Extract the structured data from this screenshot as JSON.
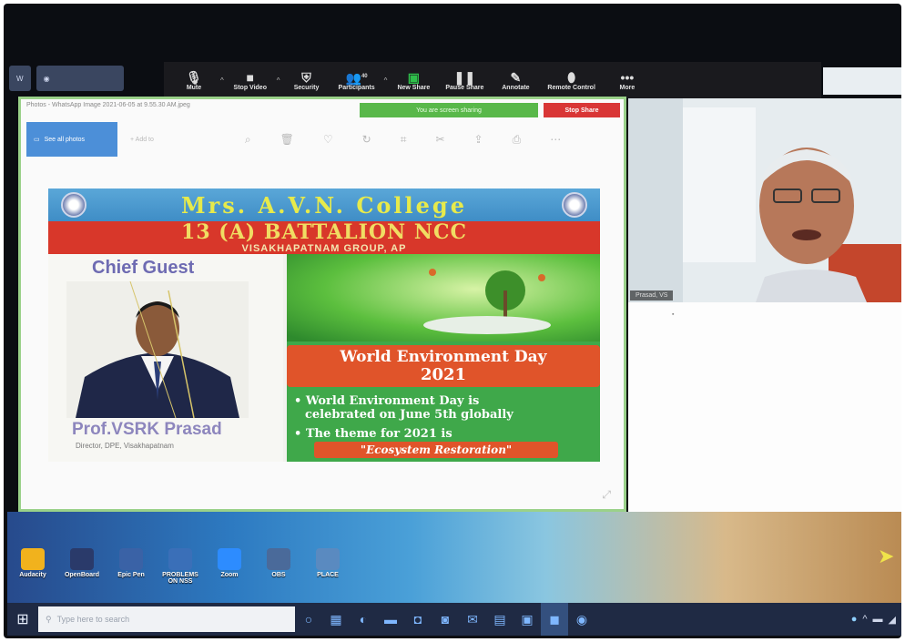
{
  "zoom_toolbar": {
    "items": [
      {
        "label": "Mute",
        "icon": "microphone-icon"
      },
      {
        "label": "Stop Video",
        "icon": "video-camera-icon"
      },
      {
        "label": "Security",
        "icon": "shield-icon"
      },
      {
        "label": "Participants",
        "icon": "participants-icon",
        "count": "40"
      },
      {
        "label": "New Share",
        "icon": "share-screen-icon"
      },
      {
        "label": "Pause Share",
        "icon": "pause-icon"
      },
      {
        "label": "Annotate",
        "icon": "pencil-icon"
      },
      {
        "label": "Remote Control",
        "icon": "mouse-icon"
      },
      {
        "label": "More",
        "icon": "more-icon"
      }
    ],
    "accent": "#2fbf4b"
  },
  "share_bar": {
    "sharing_text": "You are screen sharing",
    "stop_share_label": "Stop Share",
    "stop_color": "#d93636"
  },
  "viewer": {
    "title": "Photos - WhatsApp Image 2021-06-05 at 9.55.30 AM.jpeg",
    "see_all_label": "See all photos",
    "add_to_label": "Add to"
  },
  "poster": {
    "college_name": "Mrs. A.V.N. College",
    "battalion": "13 (A) BATTALION NCC",
    "group": "VISAKHAPATNAM GROUP, AP",
    "chief_guest_heading": "Chief Guest",
    "guest_name": "Prof.VSRK Prasad",
    "guest_title": "Director, DPE, Visakhapatnam",
    "event_title": "World Environment Day",
    "event_year": "2021",
    "bullet1_line1": "World Environment Day is",
    "bullet1_line2": "celebrated on June 5th globally",
    "bullet2": "The theme for 2021 is",
    "theme": "\"Ecosystem Restoration\""
  },
  "video": {
    "speaker_label": "Prasad, VS"
  },
  "desktop": {
    "icons": [
      "Audacity",
      "OpenBoard",
      "Epic Pen",
      "PROBLEMS ON NSS",
      "Zoom",
      "OBS",
      "PLACE"
    ]
  },
  "taskbar": {
    "search_placeholder": "Type here to search",
    "start_icon": "windows-start-icon"
  }
}
